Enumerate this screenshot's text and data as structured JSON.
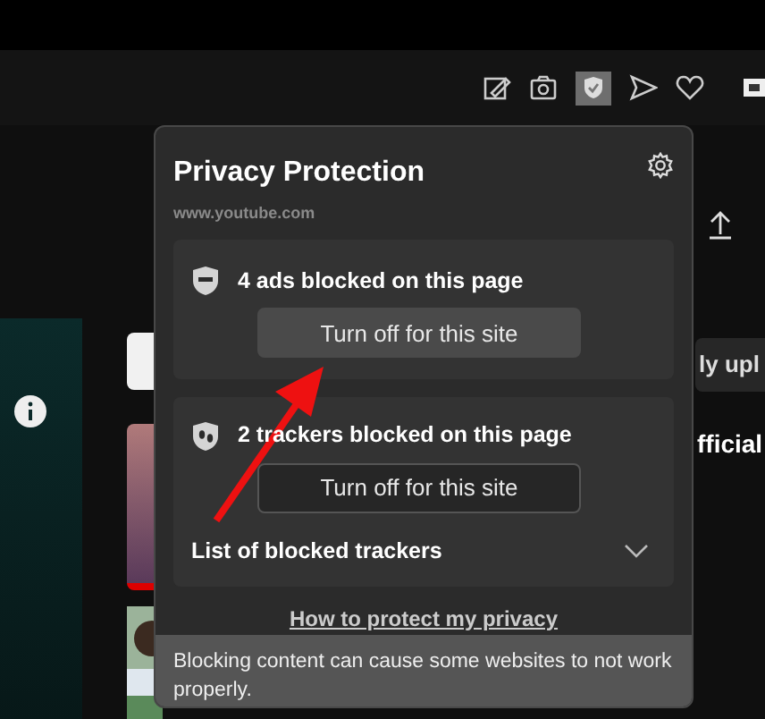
{
  "popup": {
    "title": "Privacy Protection",
    "domain": "www.youtube.com",
    "cards": [
      {
        "kind": "ads",
        "heading": "4 ads blocked on this page",
        "button": {
          "label": "Turn off for this site",
          "hovered": true
        }
      },
      {
        "kind": "trackers",
        "heading": "2 trackers blocked on this page",
        "button": {
          "label": "Turn off for this site",
          "hovered": false
        },
        "list": {
          "label": "List of blocked trackers",
          "expanded": false
        }
      }
    ],
    "link": "How to protect my privacy",
    "note": "Blocking content can cause some websites to not work properly."
  },
  "background": {
    "chip_text": "ly upl",
    "video_title": "fficial"
  }
}
